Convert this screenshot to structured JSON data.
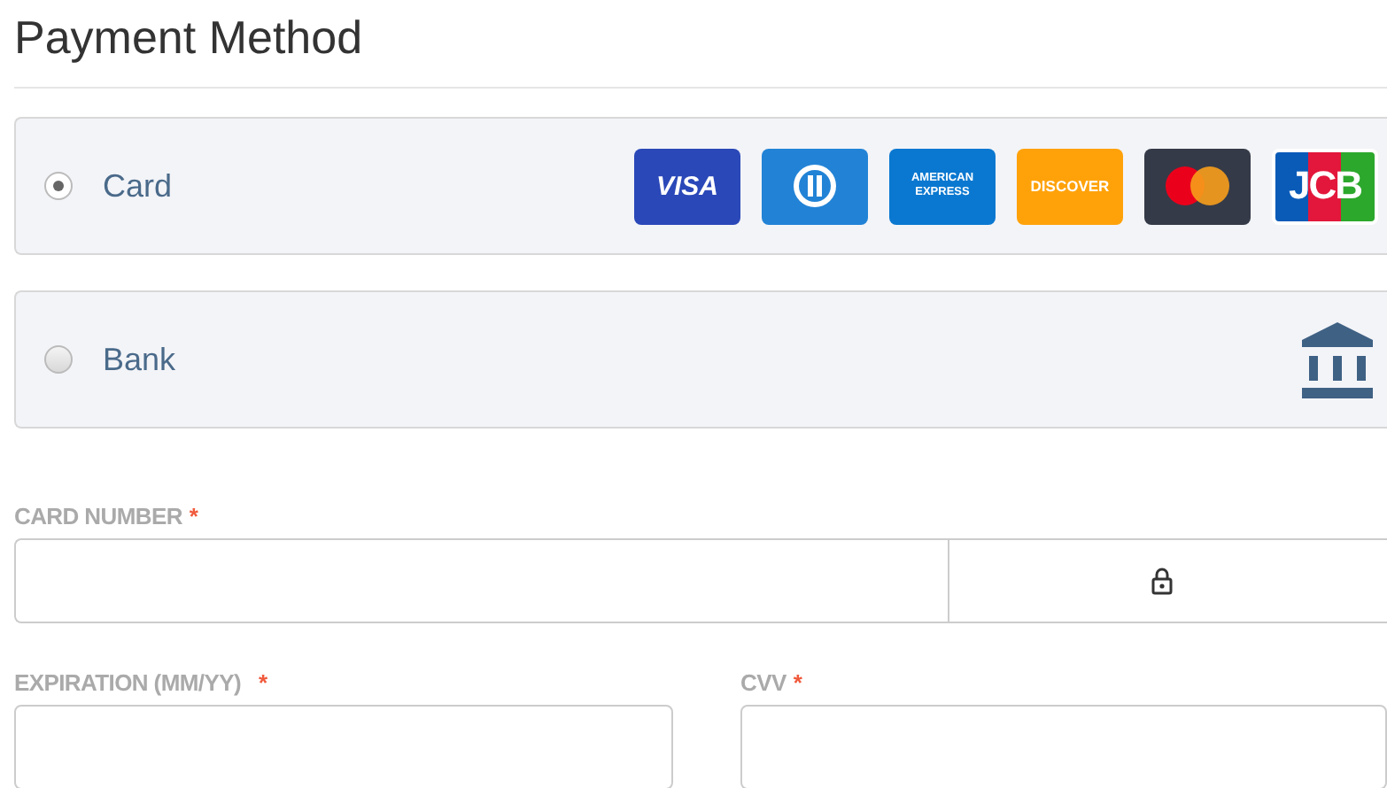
{
  "title": "Payment Method",
  "methods": [
    {
      "label": "Card",
      "selected": true,
      "kind": "cards",
      "badges": [
        {
          "kind": "visa",
          "label": "VISA"
        },
        {
          "kind": "diners"
        },
        {
          "kind": "amex",
          "label": "AMERICAN EXPRESS"
        },
        {
          "kind": "discover",
          "label": "DISCOVER"
        },
        {
          "kind": "mastercard"
        },
        {
          "kind": "jcb",
          "label": "JCB"
        }
      ]
    },
    {
      "label": "Bank",
      "selected": false,
      "kind": "bank"
    }
  ],
  "fields": [
    {
      "label": "CARD NUMBER",
      "required_mark": "*",
      "kind": "card-number"
    },
    {
      "label": "EXPIRATION (MM/YY)",
      "required_mark": "*",
      "kind": "half"
    },
    {
      "label": "CVV",
      "required_mark": "*",
      "kind": "half"
    }
  ]
}
